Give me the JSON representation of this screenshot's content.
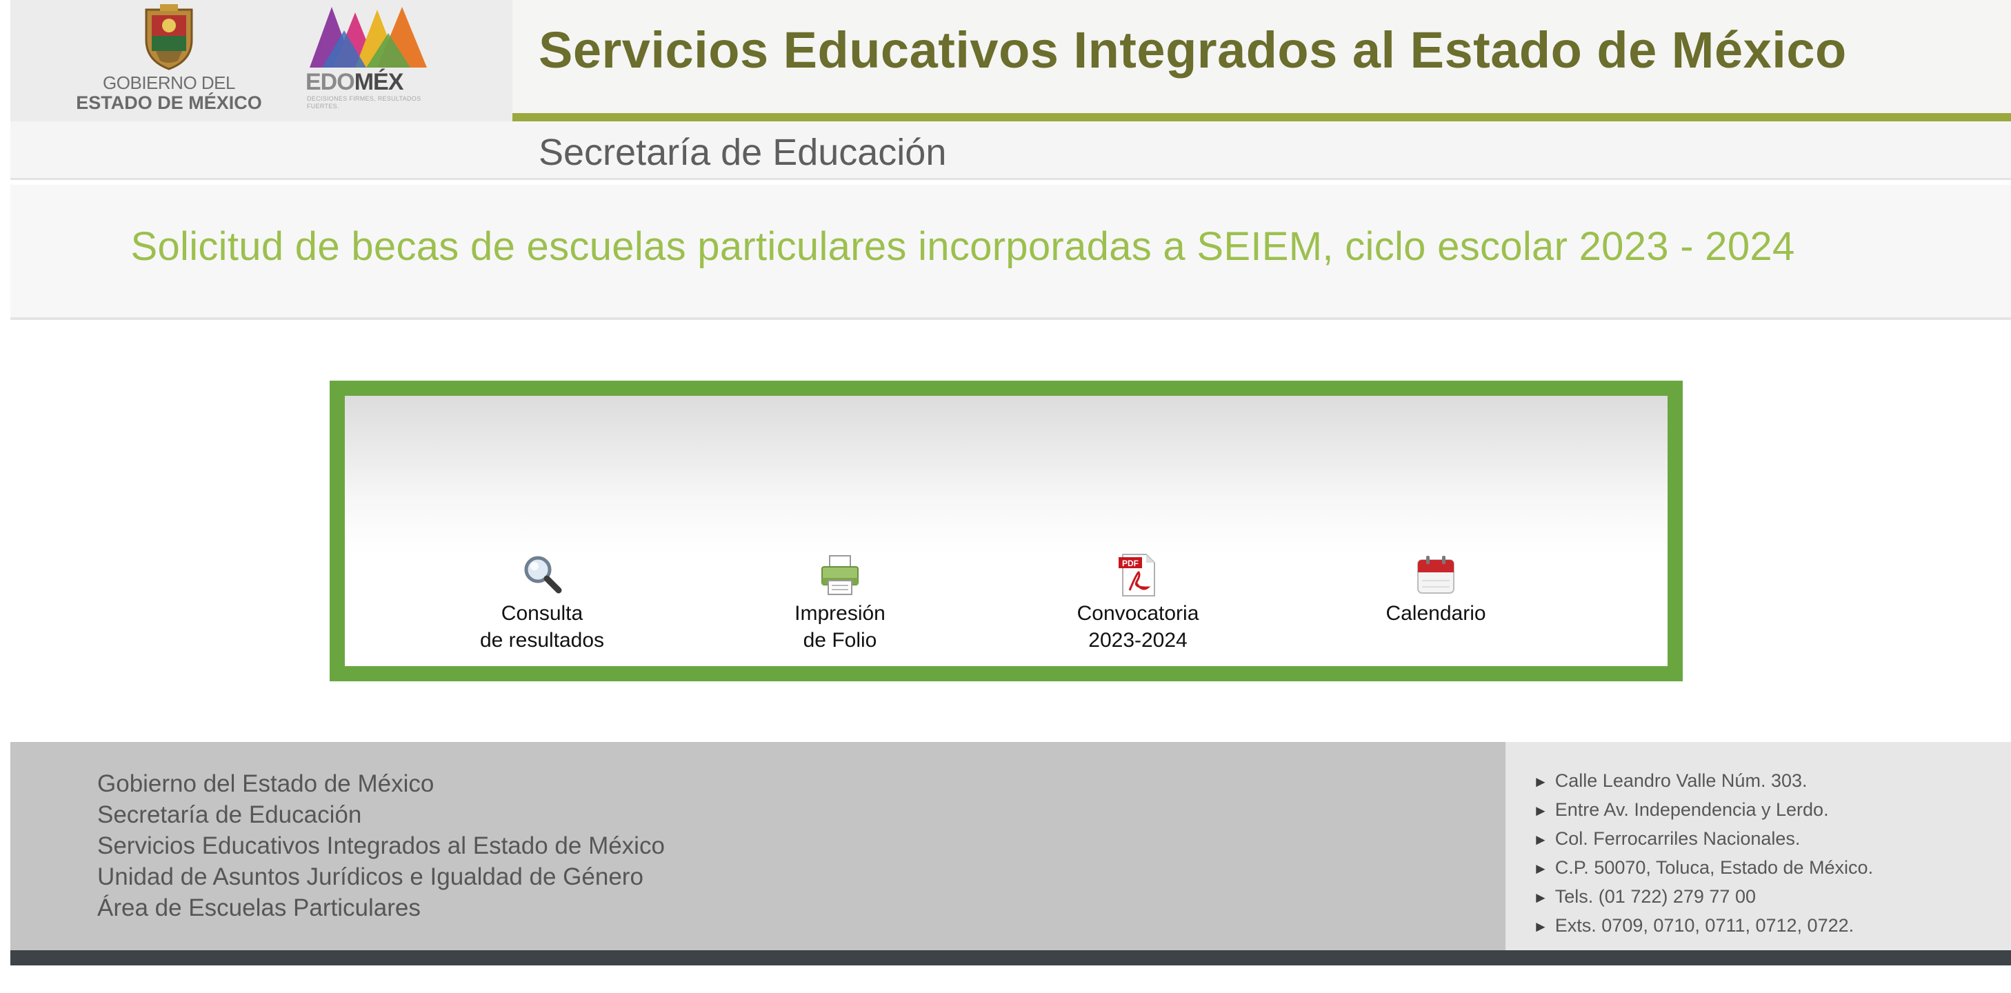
{
  "header": {
    "gov_logo_line1": "GOBIERNO DEL",
    "gov_logo_line2": "ESTADO DE MÉXICO",
    "edomex_logo_edo": "EDO",
    "edomex_logo_mex": "MÉX",
    "edomex_tagline": "DECISIONES FIRMES, RESULTADOS FUERTES.",
    "title": "Servicios Educativos Integrados al Estado de México",
    "subtitle": "Secretaría de Educación"
  },
  "banner": {
    "title": "Solicitud de becas de escuelas particulares incorporadas a SEIEM, ciclo escolar 2023 - 2024"
  },
  "menu": {
    "items": [
      {
        "label": "Consulta\nde resultados",
        "icon": "magnifier-icon"
      },
      {
        "label": "Impresión\nde Folio",
        "icon": "printer-icon"
      },
      {
        "label": "Convocatoria\n2023-2024",
        "icon": "pdf-icon"
      },
      {
        "label": "Calendario",
        "icon": "calendar-icon"
      }
    ]
  },
  "footer": {
    "left_lines": [
      "Gobierno del Estado de México",
      "Secretaría de Educación",
      "Servicios Educativos Integrados al Estado de México",
      "Unidad de Asuntos Jurídicos e Igualdad de Género",
      "Área de Escuelas Particulares"
    ],
    "address_lines": [
      "Calle Leandro Valle Núm. 303.",
      "Entre Av. Independencia y Lerdo.",
      "Col. Ferrocarriles Nacionales.",
      "C.P. 50070, Toluca, Estado de México.",
      "Tels. (01 722) 279 77 00",
      "Exts. 0709, 0710, 0711, 0712, 0722."
    ]
  },
  "colors": {
    "accent_green": "#6aa63f",
    "banner_green": "#9cbf4e",
    "title_olive": "#6b6e2c",
    "title_rule": "#9aa83e"
  }
}
